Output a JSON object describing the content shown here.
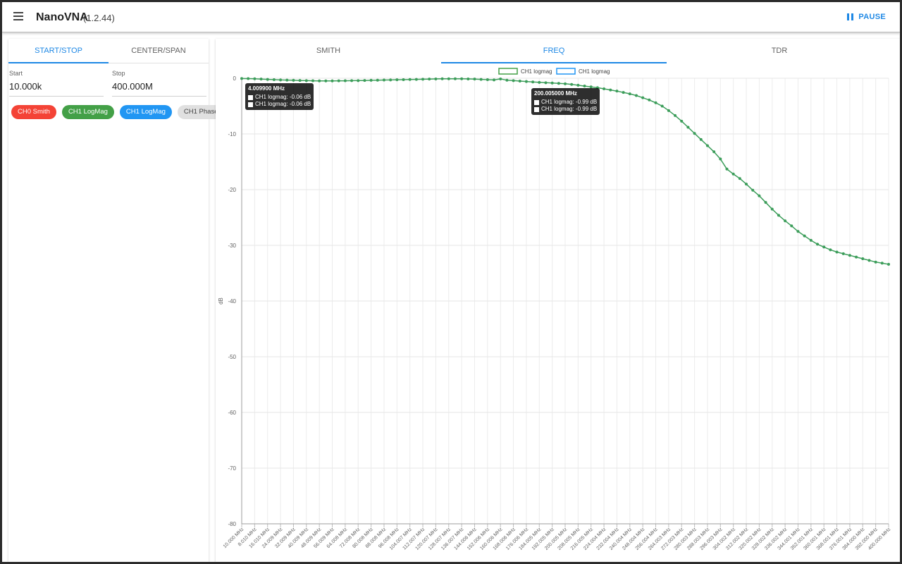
{
  "app": {
    "title": "NanoVNA",
    "version": "(1.2.44)",
    "pause_label": "PAUSE"
  },
  "icons": {
    "menu": "hamburger-menu-icon",
    "pause": "pause-icon"
  },
  "colors": {
    "accent": "#1e88e5",
    "ch0_smith": "#f44336",
    "ch1_logmag_green": "#43a047",
    "ch1_logmag_blue": "#2196f3",
    "ch1_phase": "#e0e0e0",
    "trace": "#3c9d5a"
  },
  "left": {
    "tabs": [
      {
        "label": "START/STOP",
        "active": true
      },
      {
        "label": "CENTER/SPAN",
        "active": false
      }
    ],
    "start": {
      "label": "Start",
      "value": "10.000k"
    },
    "stop": {
      "label": "Stop",
      "value": "400.000M"
    },
    "chips": [
      {
        "label": "CH0 Smith",
        "color": "#f44336",
        "text_color": "#ffffff"
      },
      {
        "label": "CH1 LogMag",
        "color": "#43a047",
        "text_color": "#ffffff"
      },
      {
        "label": "CH1 LogMag",
        "color": "#2196f3",
        "text_color": "#ffffff"
      },
      {
        "label": "CH1 Phase",
        "color": "#e0e0e0",
        "text_color": "#424242"
      }
    ]
  },
  "right": {
    "tabs": [
      {
        "label": "SMITH",
        "active": false
      },
      {
        "label": "FREQ",
        "active": true
      },
      {
        "label": "TDR",
        "active": false
      }
    ]
  },
  "tooltips": [
    {
      "title": "4.009900 MHz",
      "rows": [
        "CH1 logmag: -0.06 dB",
        "CH1 logmag: -0.06 dB"
      ]
    },
    {
      "title": "200.005000 MHz",
      "rows": [
        "CH1 logmag: -0.99 dB",
        "CH1 logmag: -0.99 dB"
      ]
    }
  ],
  "chart_data": {
    "type": "line",
    "ylabel": "dB",
    "ylim": [
      -80,
      0
    ],
    "y_ticks": [
      0,
      -10,
      -20,
      -30,
      -40,
      -50,
      -60,
      -70,
      -80
    ],
    "grid": true,
    "legend": {
      "placement": "top-center",
      "entries": [
        {
          "label": "CH1 logmag",
          "color": "#43a047"
        },
        {
          "label": "CH1 logmag",
          "color": "#2196f3"
        }
      ]
    },
    "x_tick_labels": [
      "10.000 MHz",
      "8.010 MHz",
      "16.010 MHz",
      "24.009 MHz",
      "32.009 MHz",
      "40.009 MHz",
      "48.009 MHz",
      "56.009 MHz",
      "64.008 MHz",
      "72.008 MHz",
      "80.008 MHz",
      "88.008 MHz",
      "96.008 MHz",
      "104.007 MHz",
      "112.007 MHz",
      "120.007 MHz",
      "128.007 MHz",
      "136.007 MHz",
      "144.006 MHz",
      "152.006 MHz",
      "160.006 MHz",
      "168.006 MHz",
      "176.006 MHz",
      "184.005 MHz",
      "192.005 MHz",
      "200.005 MHz",
      "208.005 MHz",
      "216.005 MHz",
      "224.004 MHz",
      "232.004 MHz",
      "240.004 MHz",
      "248.004 MHz",
      "256.004 MHz",
      "264.003 MHz",
      "272.003 MHz",
      "280.003 MHz",
      "288.003 MHz",
      "296.003 MHz",
      "304.002 MHz",
      "312.002 MHz",
      "320.002 MHz",
      "328.002 MHz",
      "336.002 MHz",
      "344.001 MHz",
      "352.001 MHz",
      "360.001 MHz",
      "368.001 MHz",
      "376.001 MHz",
      "384.000 MHz",
      "392.000 MHz",
      "400.000 MHz"
    ],
    "x_range_mhz": [
      0.01,
      400
    ],
    "series": [
      {
        "name": "CH1 logmag",
        "color": "#3c9d5a",
        "x_mhz": [
          0.01,
          4.01,
          8.01,
          12.01,
          16.01,
          20.01,
          24.01,
          28.01,
          32.01,
          36.01,
          40.01,
          44.01,
          48.01,
          52.01,
          56.01,
          60.01,
          64.01,
          68.01,
          72.01,
          76.01,
          80.01,
          84.01,
          88.01,
          92.01,
          96.01,
          100.01,
          104.01,
          108.01,
          112.01,
          116.01,
          120.01,
          124.01,
          128.01,
          132.01,
          136.01,
          140.01,
          144.01,
          148.01,
          152.01,
          156.01,
          160.01,
          164.01,
          168.01,
          172.01,
          176.01,
          180.01,
          184.01,
          188.01,
          192.01,
          196.01,
          200.01,
          204.0,
          208.0,
          212.0,
          216.0,
          220.0,
          224.0,
          228.0,
          232.0,
          236.0,
          240.0,
          244.0,
          248.0,
          252.0,
          256.0,
          260.0,
          264.0,
          268.0,
          272.0,
          276.0,
          280.0,
          284.0,
          288.0,
          292.0,
          296.0,
          300.0,
          304.0,
          308.0,
          312.0,
          316.0,
          320.0,
          324.0,
          328.0,
          332.0,
          336.0,
          340.0,
          344.0,
          348.0,
          352.0,
          356.0,
          360.0,
          364.0,
          368.0,
          372.0,
          376.0,
          380.0,
          384.0,
          388.0,
          392.0,
          396.0,
          400.0
        ],
        "db": [
          -0.05,
          -0.06,
          -0.1,
          -0.15,
          -0.2,
          -0.25,
          -0.3,
          -0.33,
          -0.36,
          -0.4,
          -0.42,
          -0.45,
          -0.47,
          -0.48,
          -0.48,
          -0.46,
          -0.45,
          -0.43,
          -0.42,
          -0.4,
          -0.37,
          -0.35,
          -0.32,
          -0.3,
          -0.27,
          -0.25,
          -0.22,
          -0.2,
          -0.18,
          -0.15,
          -0.12,
          -0.1,
          -0.1,
          -0.1,
          -0.1,
          -0.12,
          -0.15,
          -0.2,
          -0.25,
          -0.3,
          -0.12,
          -0.35,
          -0.42,
          -0.5,
          -0.58,
          -0.66,
          -0.74,
          -0.8,
          -0.86,
          -0.92,
          -0.99,
          -1.1,
          -1.25,
          -1.4,
          -1.55,
          -1.7,
          -1.9,
          -2.1,
          -2.3,
          -2.55,
          -2.8,
          -3.1,
          -3.5,
          -3.9,
          -4.4,
          -5.0,
          -5.8,
          -6.7,
          -7.7,
          -8.8,
          -9.9,
          -11.0,
          -12.1,
          -13.2,
          -14.5,
          -16.3,
          -17.2,
          -18.0,
          -19.0,
          -20.1,
          -21.1,
          -22.3,
          -23.5,
          -24.6,
          -25.6,
          -26.5,
          -27.5,
          -28.3,
          -29.1,
          -29.8,
          -30.3,
          -30.8,
          -31.2,
          -31.5,
          -31.8,
          -32.1,
          -32.4,
          -32.7,
          -33.0,
          -33.2,
          -33.4
        ]
      }
    ]
  }
}
